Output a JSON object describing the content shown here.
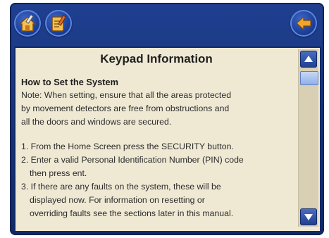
{
  "toolbar": {
    "home_icon": "house-with-tools-icon",
    "notes_icon": "notepad-pencil-icon",
    "back_icon": "back-arrow-icon"
  },
  "document": {
    "title": "Keypad Information",
    "heading": "How to Set the System",
    "note_lines": [
      "Note: When setting, ensure that all the areas protected",
      "by movement detectors are free from obstructions and",
      "all the doors and windows are secured."
    ],
    "step_lines": [
      "1. From the Home Screen press the SECURITY button.",
      "2. Enter a valid Personal Identification Number (PIN) code",
      "    then press ent.",
      "3. If there are any faults on the system, these will be",
      "    displayed now. For information on resetting or",
      "    overriding faults see the sections later in this manual."
    ]
  },
  "colors": {
    "frame": "#173377",
    "screen": "#efe9d4",
    "accent_orange": "#f2a52a"
  },
  "scrollbar": {
    "up_icon": "scroll-up-arrow-icon",
    "down_icon": "scroll-down-arrow-icon",
    "position_fraction": 0.05
  }
}
